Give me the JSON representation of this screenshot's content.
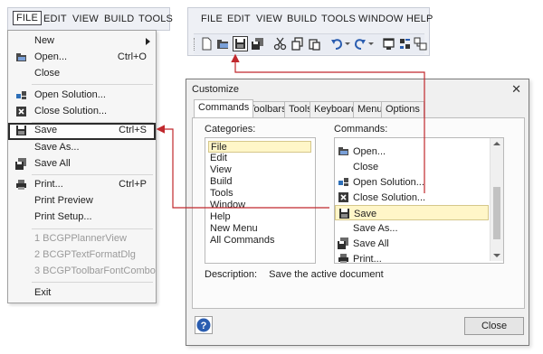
{
  "left_menubar": {
    "items": [
      "FILE",
      "EDIT",
      "VIEW",
      "BUILD",
      "TOOLS"
    ]
  },
  "file_menu": {
    "items": [
      {
        "label": "New",
        "shortcut": "",
        "icon": "",
        "submenu": true
      },
      {
        "label": "Open...",
        "shortcut": "Ctrl+O",
        "icon": "open-folder-icon"
      },
      {
        "label": "Close",
        "shortcut": "",
        "icon": ""
      },
      {
        "label": "Open Solution...",
        "shortcut": "",
        "icon": "open-solution-icon"
      },
      {
        "label": "Close Solution...",
        "shortcut": "",
        "icon": "close-solution-icon"
      },
      {
        "label": "Save",
        "shortcut": "Ctrl+S",
        "icon": "save-icon"
      },
      {
        "label": "Save As...",
        "shortcut": "",
        "icon": ""
      },
      {
        "label": "Save All",
        "shortcut": "",
        "icon": "save-all-icon"
      },
      {
        "label": "Print...",
        "shortcut": "Ctrl+P",
        "icon": "print-icon"
      },
      {
        "label": "Print Preview",
        "shortcut": "",
        "icon": ""
      },
      {
        "label": "Print Setup...",
        "shortcut": "",
        "icon": ""
      },
      {
        "label": "1 BCGPPlannerView",
        "shortcut": "",
        "icon": ""
      },
      {
        "label": "2 BCGPTextFormatDlg",
        "shortcut": "",
        "icon": ""
      },
      {
        "label": "3 BCGPToolbarFontCombo",
        "shortcut": "",
        "icon": ""
      },
      {
        "label": "Exit",
        "shortcut": "",
        "icon": ""
      }
    ]
  },
  "top_menubar": {
    "items": [
      "FILE",
      "EDIT",
      "VIEW",
      "BUILD",
      "TOOLS",
      "WINDOW",
      "HELP"
    ]
  },
  "toolbar": {
    "buttons": [
      "new-file-icon",
      "open-folder-icon",
      "save-icon",
      "save-all-icon",
      "cut-icon",
      "copy-icon",
      "paste-icon",
      "undo-icon",
      "redo-icon",
      "window-icon",
      "properties-icon",
      "class-view-icon"
    ]
  },
  "dialog": {
    "title": "Customize",
    "close_glyph": "✕",
    "tabs": [
      "Commands",
      "Toolbars",
      "Tools",
      "Keyboard",
      "Menu",
      "Options"
    ],
    "categories_label": "Categories:",
    "categories": [
      "File",
      "Edit",
      "View",
      "Build",
      "Tools",
      "Window",
      "Help",
      "New Menu",
      "All Commands"
    ],
    "commands_label": "Commands:",
    "commands": [
      {
        "label": "Open...",
        "icon": "open-folder-icon"
      },
      {
        "label": "Close",
        "icon": ""
      },
      {
        "label": "Open Solution...",
        "icon": "open-solution-icon"
      },
      {
        "label": "Close Solution...",
        "icon": "close-solution-icon"
      },
      {
        "label": "Save",
        "icon": "save-icon"
      },
      {
        "label": "Save As...",
        "icon": ""
      },
      {
        "label": "Save All",
        "icon": "save-all-icon"
      },
      {
        "label": "Print...",
        "icon": "print-icon"
      }
    ],
    "description_label": "Description:",
    "description_text": "Save the active document",
    "help_glyph": "?",
    "close_button": "Close"
  },
  "colors": {
    "connector": "#c0282d",
    "selection_bg": "#fff6c8",
    "help_blue": "#2a5db0"
  }
}
